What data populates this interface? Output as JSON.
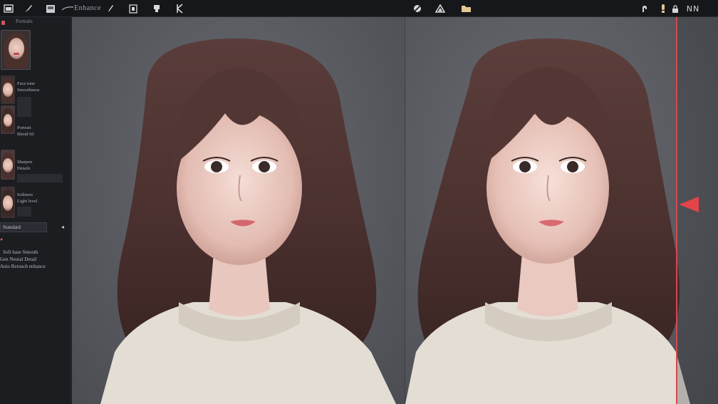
{
  "toolbar": {
    "label": "Enhance",
    "left_icons": [
      "window-icon",
      "brush-icon",
      "image-icon",
      "stroke-icon",
      "pen-icon",
      "layers-icon",
      "stamp-icon",
      "crop-icon"
    ],
    "center_icons": [
      "wand-icon",
      "triangle-icon",
      "folder-icon"
    ],
    "right_icons": [
      "hand-icon",
      "info-icon",
      "compare-icon"
    ],
    "compare_label": "NN"
  },
  "sidebar": {
    "header": "Portraits",
    "items": [
      {
        "line1": "Face tone",
        "line2": "Smoothness"
      },
      {
        "line1": "Portrait",
        "line2": "Blend 60"
      },
      {
        "line1": "Sharpen",
        "line2": "Details"
      },
      {
        "line1": "Softness",
        "line2": "Light level"
      }
    ],
    "select_value": "Standard",
    "notes": [
      "Soft base Smooth",
      "Gen Neural Detail",
      "Auto Retouch enhance"
    ]
  },
  "colors": {
    "accent": "#e2444a",
    "toolbar_bg": "#16171a",
    "canvas_bg": "#5a5c62"
  }
}
